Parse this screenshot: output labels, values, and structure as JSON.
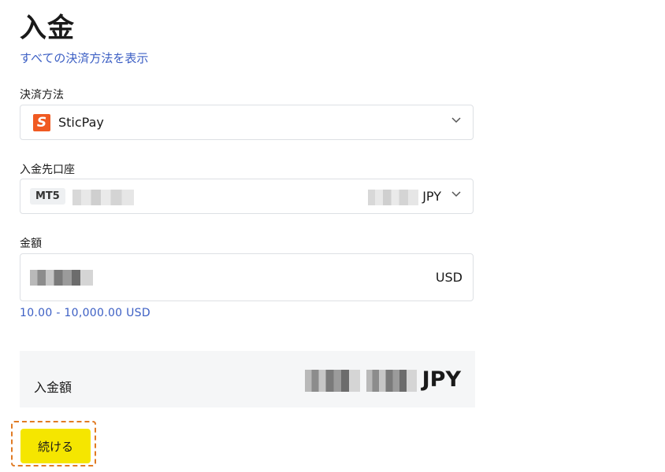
{
  "page": {
    "title": "入金",
    "show_all_methods_link": "すべての決済方法を表示"
  },
  "payment_method": {
    "label": "決済方法",
    "value": "SticPay",
    "logo_letter": "S"
  },
  "account": {
    "label": "入金先口座",
    "platform_badge": "MT5",
    "currency": "JPY"
  },
  "amount": {
    "label": "金額",
    "currency": "USD",
    "range_hint": "10.00 - 10,000.00 USD"
  },
  "summary": {
    "label": "入金額",
    "currency": "JPY"
  },
  "actions": {
    "continue_label": "続ける"
  },
  "colors": {
    "link": "#3c5fc4",
    "button": "#f5e600",
    "logo": "#f05a22",
    "highlight_outline": "#e07b24"
  }
}
